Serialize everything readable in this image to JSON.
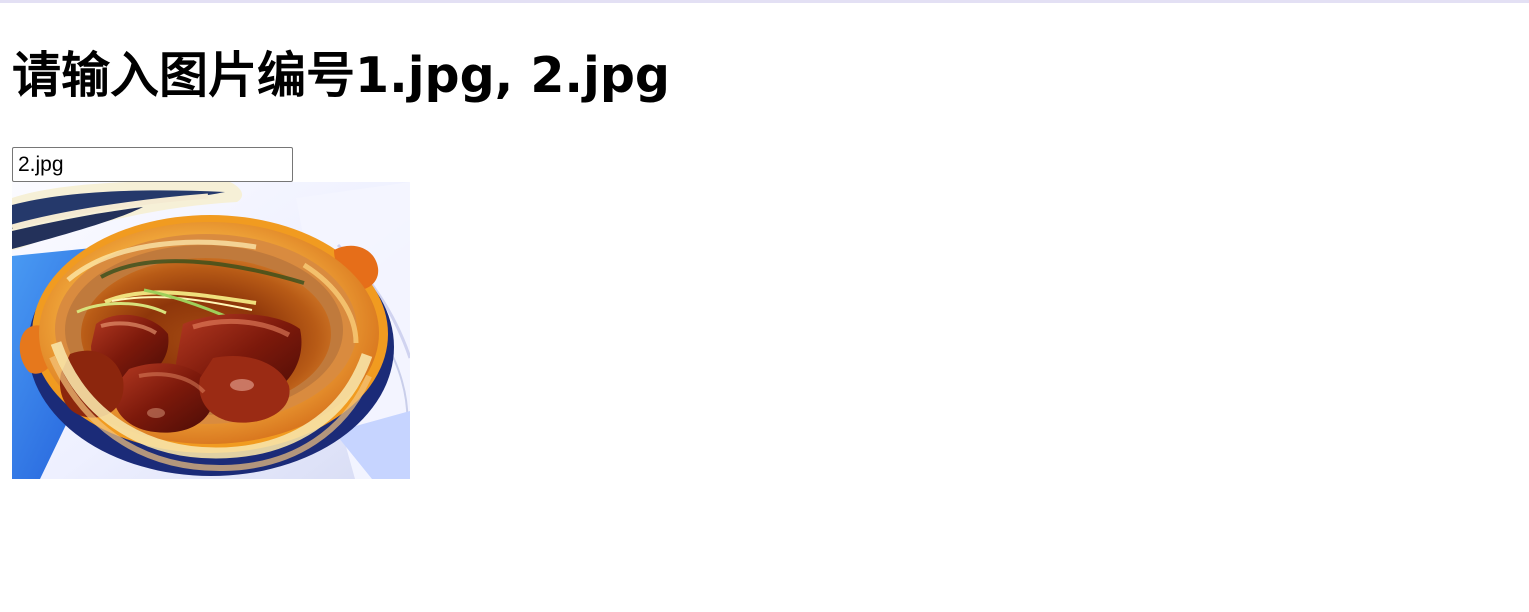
{
  "page": {
    "title": "请输入图片编号1.jpg, 2.jpg"
  },
  "filename_input": {
    "value": "2.jpg",
    "placeholder": ""
  },
  "image": {
    "alt": "2.jpg",
    "content": "photo-braised-pork-in-clay-pot"
  },
  "colors": {
    "background": "#ffffff",
    "top_border": "#e3e0f4",
    "text": "#000000",
    "input_border": "#767676"
  }
}
